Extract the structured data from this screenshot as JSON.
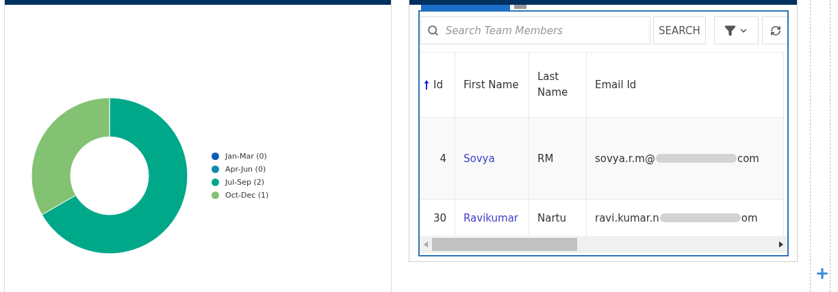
{
  "chart_panel": {
    "chart_data": {
      "type": "donut",
      "categories": [
        "Jan-Mar (0)",
        "Apr-Jun (0)",
        "Jul-Sep (2)",
        "Oct-Dec (1)"
      ],
      "values": [
        0,
        0,
        2,
        1
      ],
      "colors": [
        "#0b5fb0",
        "#0f8bb0",
        "#00a88a",
        "#82c272"
      ]
    }
  },
  "grid": {
    "search": {
      "placeholder": "Search Team Members"
    },
    "search_button": "SEARCH",
    "columns": [
      {
        "label": "Id",
        "sorted": true
      },
      {
        "label": "First Name",
        "sorted": false
      },
      {
        "label": "Last Name",
        "sorted": false
      },
      {
        "label": "Email Id",
        "sorted": false
      }
    ],
    "rows": [
      {
        "id": "4",
        "first_name": "Sovya",
        "last_name": "RM",
        "email_start": "sovya.r.m@",
        "email_end": "com"
      },
      {
        "id": "30",
        "first_name": "Ravikumar",
        "last_name": "Nartu",
        "email_start": "ravi.kumar.n",
        "email_end": "om"
      }
    ]
  }
}
